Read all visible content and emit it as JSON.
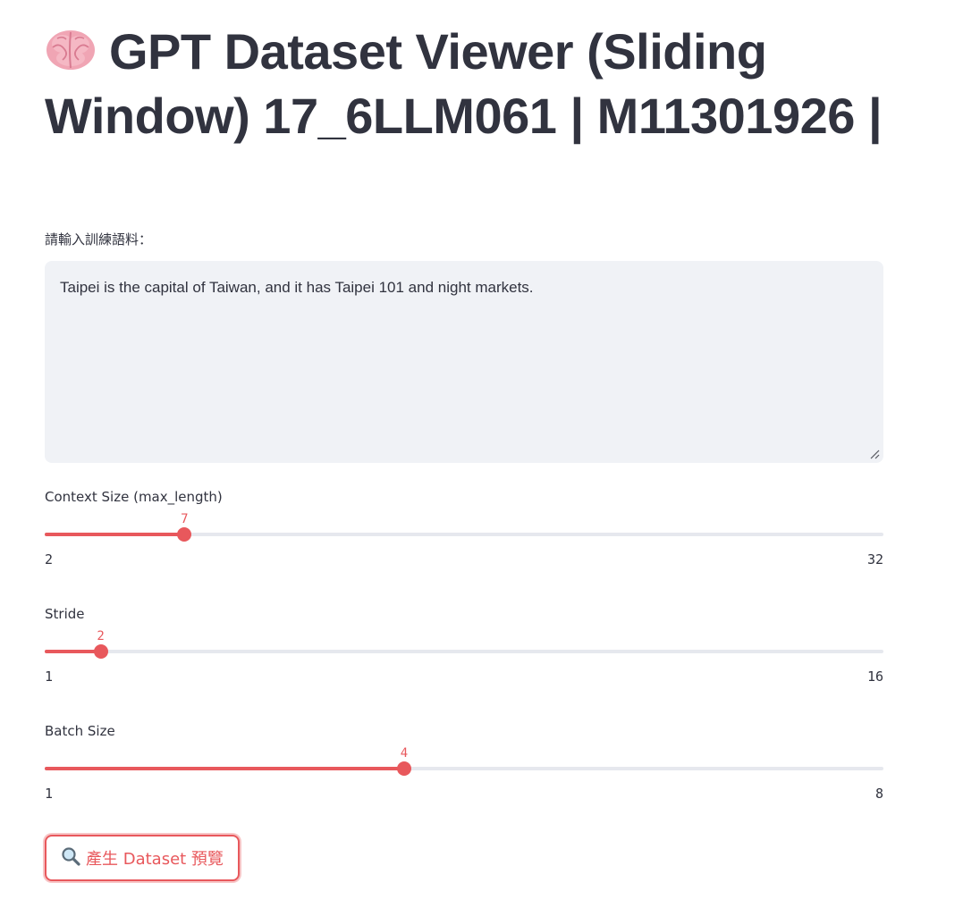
{
  "header": {
    "title": "GPT Dataset Viewer (Sliding Window) 17_6LLM061 | M11301926 |",
    "icon": "brain-emoji"
  },
  "corpus": {
    "label": "請輸入訓練語料：",
    "value": "Taipei is the capital of Taiwan, and it has Taipei 101 and night markets."
  },
  "sliders": [
    {
      "label": "Context Size (max_length)",
      "value": 7,
      "min": 2,
      "max": 32
    },
    {
      "label": "Stride",
      "value": 2,
      "min": 1,
      "max": 16
    },
    {
      "label": "Batch Size",
      "value": 4,
      "min": 1,
      "max": 8
    }
  ],
  "generate_button": {
    "label": "產生 Dataset 預覽",
    "icon": "magnifier-icon"
  },
  "colors": {
    "accent": "#e8585c",
    "text": "#31333f",
    "input_bg": "#f0f2f6",
    "track": "#e6e8ee"
  }
}
